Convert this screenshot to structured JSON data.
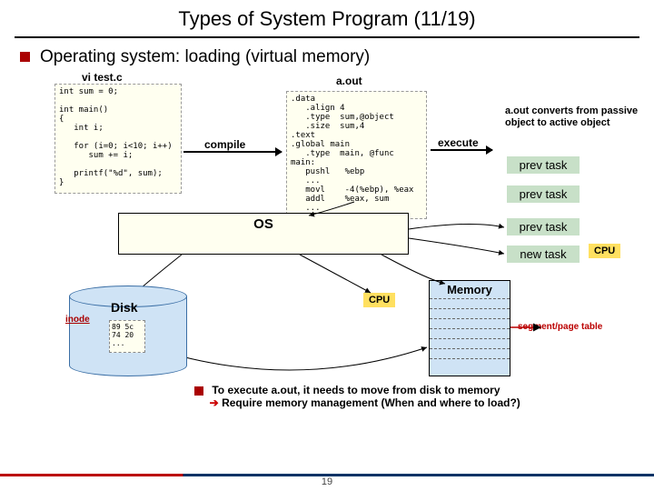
{
  "title": "Types of System Program (11/19)",
  "section": "Operating system: loading (virtual memory)",
  "source": {
    "label": "vi test.c",
    "code": "int sum = 0;\n\nint main()\n{\n   int i;\n\n   for (i=0; i<10; i++)\n      sum += i;\n\n   printf(\"%d\", sum);\n}"
  },
  "compile_label": "compile",
  "aout": {
    "label": "a.out",
    "code": ".data\n   .align 4\n   .type  sum,@object\n   .size  sum,4\n.text\n.global main\n   .type  main, @func\nmain:\n   pushl   %ebp\n   ...\n   movl    -4(%ebp), %eax\n   addl    %eax, sum\n   ..."
  },
  "execute_label": "execute",
  "convert_text": "a.out converts from passive object to active object",
  "tasks": {
    "prev": "prev task",
    "new": "new task",
    "cpu": "CPU"
  },
  "os_label": "OS",
  "disk": {
    "label": "Disk",
    "inode": "inode",
    "file": "89 5c\n74 20\n..."
  },
  "memory": {
    "title": "Memory"
  },
  "seg_label": "segment/page table",
  "bottom": {
    "line1": "To execute a.out, it needs to move from disk to memory",
    "line2": "Require memory management (When and where to load?)"
  },
  "page_num": "19"
}
